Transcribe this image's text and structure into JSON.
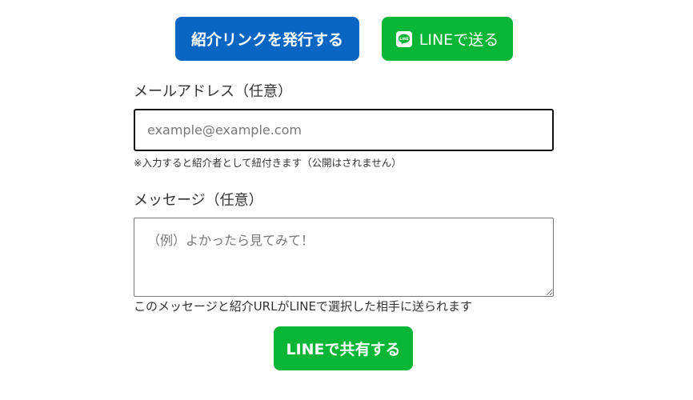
{
  "actions": {
    "issue_link_label": "紹介リンクを発行する",
    "line_send_label": "LINEで送る",
    "line_icon": "line-logo-icon"
  },
  "email_field": {
    "label": "メールアドレス（任意）",
    "value": "",
    "placeholder": "example@example.com",
    "note": "※入力すると紹介者として紐付きます（公開はされません）"
  },
  "message_field": {
    "label": "メッセージ（任意）",
    "value": "",
    "placeholder": "（例）よかったら見てみて！",
    "note": "このメッセージと紹介URLがLINEで選択した相手に送られます"
  },
  "share": {
    "label": "LINEで共有する"
  },
  "colors": {
    "primary_blue": "#0b65c2",
    "line_green": "#0bb536",
    "text": "#333333"
  }
}
